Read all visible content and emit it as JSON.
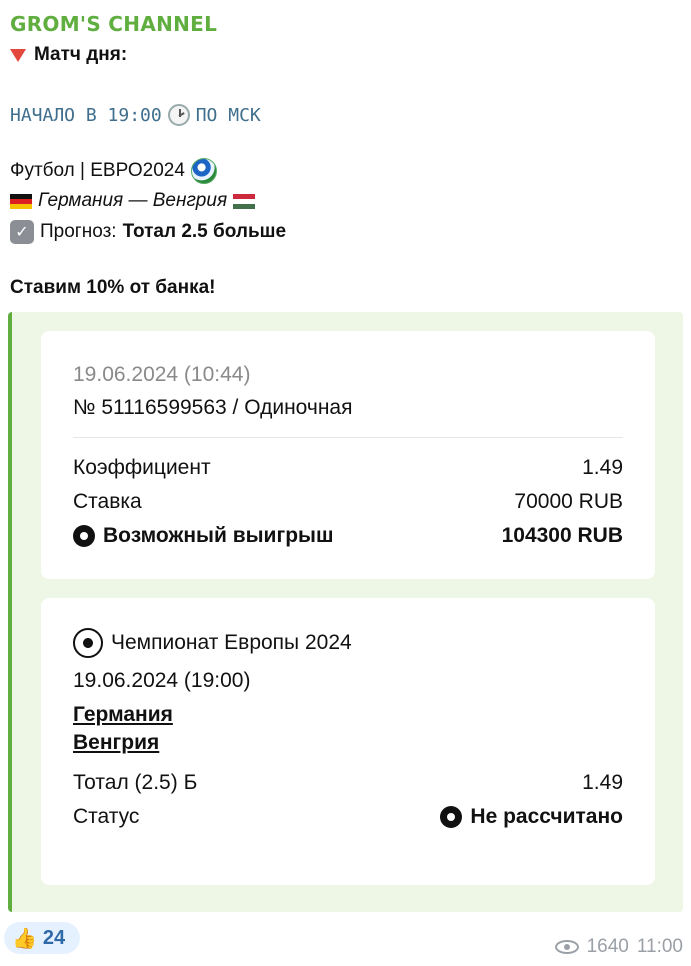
{
  "channel_name": "GROM'S CHANNEL",
  "message": {
    "match_title": "Матч дня:",
    "start_text": "НАЧАЛО В 19:00",
    "start_suffix": "ПО МСК",
    "sport_line": "Футбол | ЕВРО2024",
    "teams_line": "Германия — Венгрия",
    "forecast_label": "Прогноз:",
    "forecast_value": "Тотал 2.5 больше",
    "bank_line": "Ставим 10% от банка!"
  },
  "bet_card": {
    "datetime": "19.06.2024 (10:44)",
    "bet_number": "№ 51116599563 / Одиночная",
    "rows": [
      {
        "label": "Коэффициент",
        "value": "1.49"
      },
      {
        "label": "Ставка",
        "value": "70000 RUB"
      }
    ],
    "win_label": "Возможный выигрыш",
    "win_value": "104300 RUB"
  },
  "event_card": {
    "tournament": "Чемпионат Европы 2024",
    "datetime": "19.06.2024 (19:00)",
    "team1": "Германия",
    "team2": "Венгрия",
    "market_label": "Тотал (2.5) Б",
    "market_value": "1.49",
    "status_label": "Статус",
    "status_value": "Не рассчитано"
  },
  "reaction": {
    "emoji": "👍",
    "count": "24"
  },
  "footer": {
    "views": "1640",
    "time": "11:00"
  },
  "colors": {
    "channel": "#5fae3f",
    "accent_bar": "#5fae3f",
    "quote_bg": "#eef6e6",
    "mono_text": "#3f6f8d"
  }
}
